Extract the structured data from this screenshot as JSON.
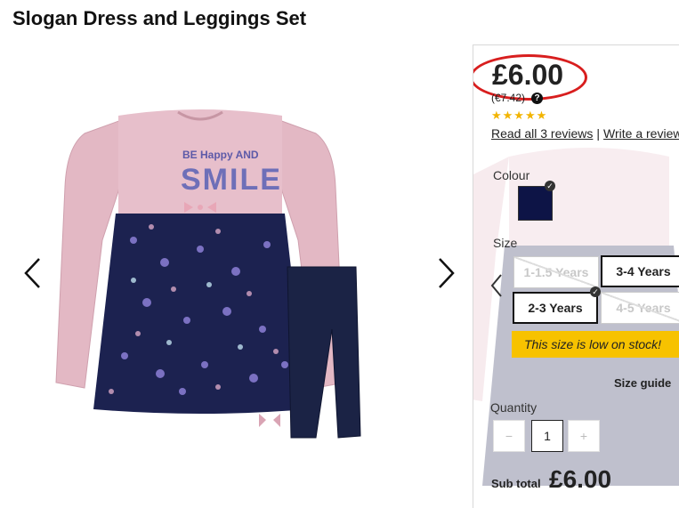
{
  "product": {
    "title": "Slogan Dress and Leggings Set",
    "price": "£6.00",
    "price_euro": "(€7.42)",
    "rating_stars": "★★★★★",
    "reviews_link": "Read all 3 reviews",
    "write_review_link": "Write a review",
    "separator": "|"
  },
  "colour": {
    "label": "Colour",
    "selected_hex": "#0d1446"
  },
  "size": {
    "label": "Size",
    "options": [
      {
        "label": "1-1.5 Years",
        "state": "disabled"
      },
      {
        "label": "3-4 Years",
        "state": "available"
      },
      {
        "label": "2-3 Years",
        "state": "selected"
      },
      {
        "label": "4-5 Years",
        "state": "disabled"
      }
    ],
    "stock_message": "This size is low on stock!",
    "guide_link": "Size guide"
  },
  "quantity": {
    "label": "Quantity",
    "minus": "−",
    "value": "1",
    "plus": "+"
  },
  "subtotal": {
    "label": "Sub total",
    "value": "£6.00"
  },
  "image_text": {
    "slogan_line1": "BE Happy AND",
    "slogan_line2": "SMILE"
  },
  "colors": {
    "price_highlight": "#d81e1e",
    "stars": "#f2b400",
    "stock_banner": "#f7c200",
    "dress_pink": "#e3b8c4",
    "dress_navy": "#1c2250",
    "leggings_navy": "#1b2345"
  }
}
